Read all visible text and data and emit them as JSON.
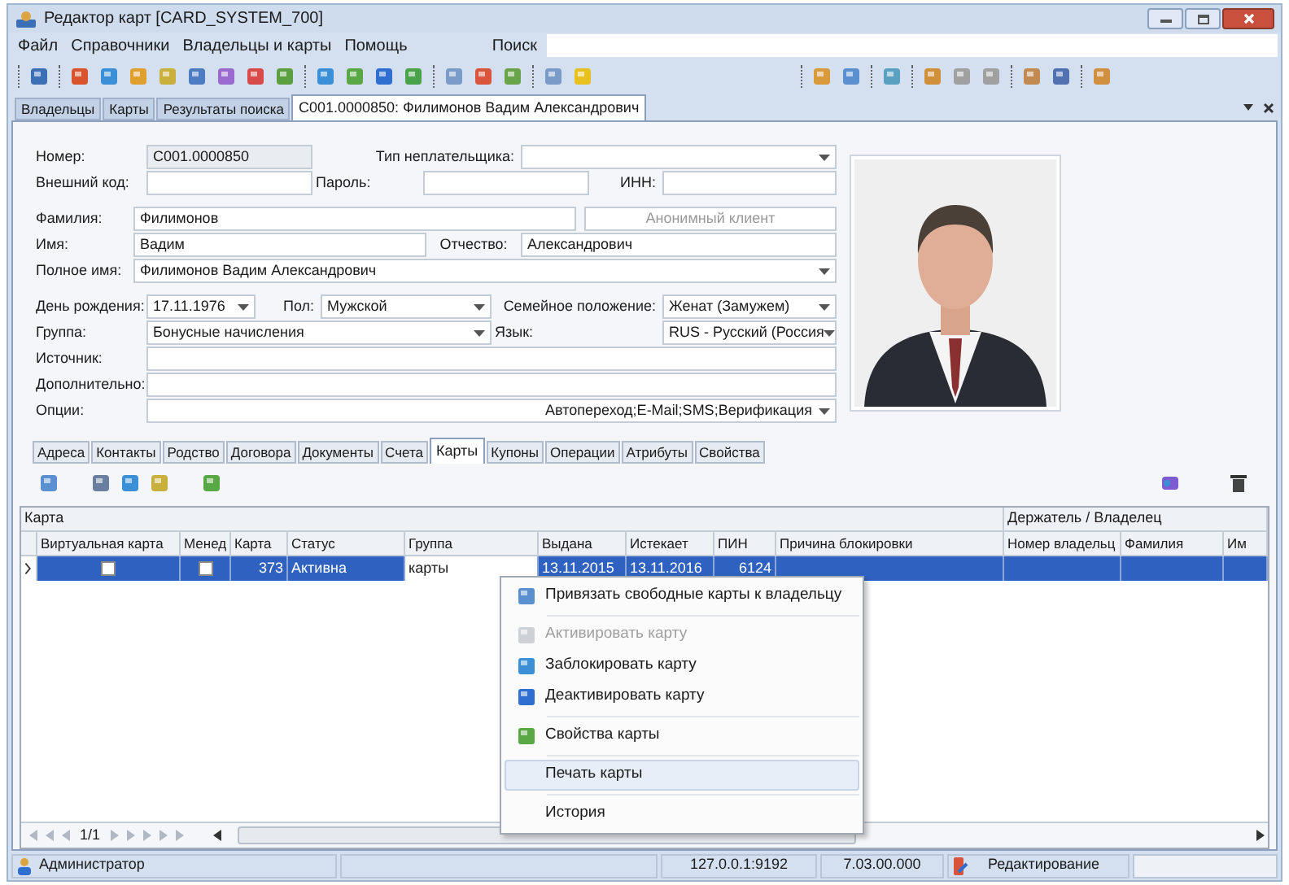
{
  "window": {
    "title": "Редактор карт [CARD_SYSTEM_700]"
  },
  "menu": [
    "Файл",
    "Справочники",
    "Владельцы и карты",
    "Помощь"
  ],
  "search": {
    "label": "Поиск"
  },
  "doc_tabs": [
    {
      "label": "Владельцы",
      "selected": false
    },
    {
      "label": "Карты",
      "selected": false
    },
    {
      "label": "Результаты поиска",
      "selected": false
    },
    {
      "label": "C001.0000850: Филимонов Вадим Александрович",
      "selected": true
    }
  ],
  "form": {
    "rows": [
      [
        {
          "kind": "readonly",
          "label": "Номер:",
          "value": "C001.0000850"
        },
        {
          "kind": "combo",
          "label": "Тип неплательщика:"
        }
      ],
      [
        {
          "kind": "text",
          "label": "Внешний код:"
        },
        {
          "kind": "text",
          "label": "Пароль:"
        },
        {
          "kind": "text",
          "label": "ИНН:"
        }
      ],
      [
        {
          "kind": "text",
          "label": "Фамилия:",
          "value": "Филимонов"
        },
        {
          "kind": "button",
          "label": "Анонимный клиент",
          "disabled": true
        }
      ],
      [
        {
          "kind": "text",
          "label": "Имя:",
          "value": "Вадим"
        },
        {
          "kind": "text",
          "label": "Отчество:",
          "value": "Александрович"
        }
      ],
      [
        {
          "kind": "combo",
          "label": "Полное имя:",
          "value": "Филимонов Вадим Александрович"
        }
      ],
      [
        {
          "kind": "combo",
          "label": "День рождения:",
          "value": "17.11.1976"
        },
        {
          "kind": "combo",
          "label": "Пол:",
          "value": "Мужской"
        },
        {
          "kind": "combo",
          "label": "Семейное положение:",
          "value": "Женат (Замужем)"
        }
      ],
      [
        {
          "kind": "combo",
          "label": "Группа:",
          "value": "Бонусные начисления"
        },
        {
          "kind": "combo",
          "label": "Язык:",
          "value": "RUS - Русский (Россия"
        }
      ],
      [
        {
          "kind": "text",
          "label": "Источник:"
        }
      ],
      [
        {
          "kind": "text",
          "label": "Дополнительно:"
        }
      ],
      [
        {
          "kind": "combo",
          "label": "Опции:",
          "value": "Автопереход;E-Mail;SMS;Верификация"
        }
      ]
    ]
  },
  "card_tabs": [
    {
      "label": "Адреса",
      "selected": false
    },
    {
      "label": "Контакты",
      "selected": false
    },
    {
      "label": "Родство",
      "selected": false
    },
    {
      "label": "Договора",
      "selected": false
    },
    {
      "label": "Документы",
      "selected": false
    },
    {
      "label": "Счета",
      "selected": false
    },
    {
      "label": "Карты",
      "selected": true
    },
    {
      "label": "Купоны",
      "selected": false
    },
    {
      "label": "Операции",
      "selected": false
    },
    {
      "label": "Атрибуты",
      "selected": false
    },
    {
      "label": "Свойства",
      "selected": false
    }
  ],
  "cards_table": {
    "group_headers": [
      "Карта",
      "Держатель / Владелец"
    ],
    "columns": [
      "Виртуальная карта",
      "Менед",
      "Карта",
      "Статус",
      "Группа",
      "Выдана",
      "Истекает",
      "ПИН",
      "Причина блокировки",
      "Номер владельц",
      "Фамилия",
      "Им"
    ],
    "rows": [
      {
        "selected": true,
        "cells": [
          {
            "kind": "check",
            "checked": false
          },
          {
            "kind": "check",
            "checked": false
          },
          {
            "kind": "text",
            "text": "373"
          },
          {
            "kind": "text",
            "text": "Активна"
          },
          {
            "kind": "edit",
            "text": "карты"
          },
          {
            "kind": "text",
            "text": "13.11.2015"
          },
          {
            "kind": "text",
            "text": "13.11.2016"
          },
          {
            "kind": "text",
            "text": "6124"
          },
          {
            "kind": "text"
          },
          {
            "kind": "text"
          },
          {
            "kind": "text"
          },
          {
            "kind": "text"
          }
        ]
      }
    ]
  },
  "context_menu": [
    {
      "kind": "item",
      "label": "Привязать свободные карты к владельцу",
      "disabled": false,
      "selected": false
    },
    {
      "kind": "separator"
    },
    {
      "kind": "item",
      "label": "Активировать карту",
      "disabled": true,
      "selected": false
    },
    {
      "kind": "item",
      "label": "Заблокировать карту",
      "disabled": false,
      "selected": false
    },
    {
      "kind": "item",
      "label": "Деактивировать карту",
      "disabled": false,
      "selected": false
    },
    {
      "kind": "separator"
    },
    {
      "kind": "item",
      "label": "Свойства карты",
      "disabled": false,
      "selected": false
    },
    {
      "kind": "separator"
    },
    {
      "kind": "item",
      "label": "Печать карты",
      "disabled": false,
      "selected": true
    },
    {
      "kind": "separator"
    },
    {
      "kind": "item",
      "label": "История",
      "disabled": false,
      "selected": false
    }
  ],
  "pager": {
    "position": "1/1"
  },
  "status_bar": {
    "user": "Администратор",
    "address": "127.0.0.1:9192",
    "version": "7.03.00.000",
    "mode": "Редактирование"
  }
}
